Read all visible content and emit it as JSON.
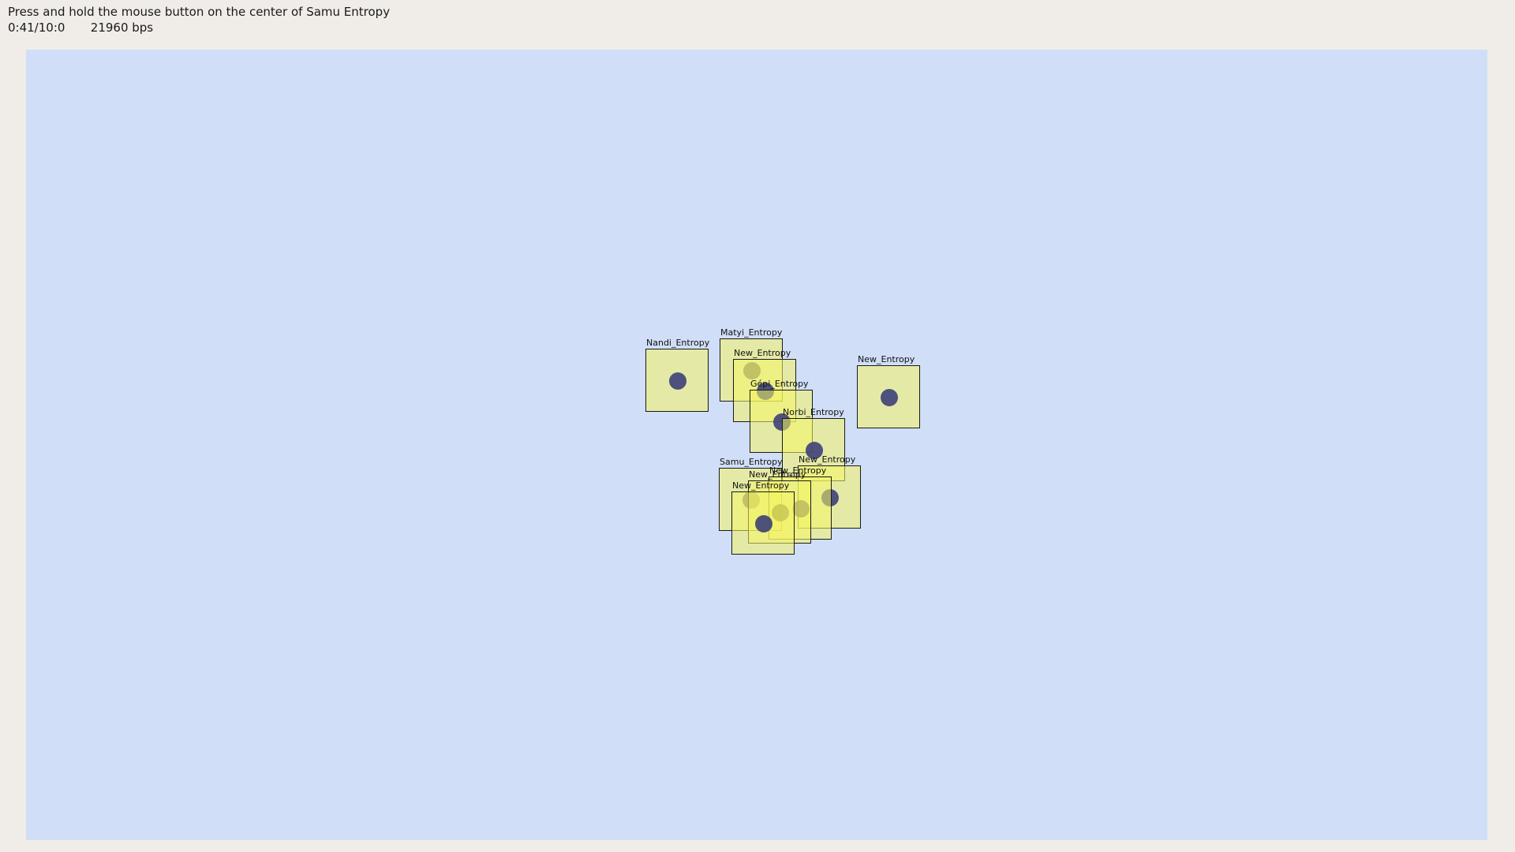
{
  "header": {
    "instruction": "Press and hold the mouse button on the center of Samu Entropy",
    "timer": "0:41/10:0",
    "bitrate": "21960 bps"
  },
  "entities": [
    {
      "label": "Nandi_Entropy"
    },
    {
      "label": "Matyi_Entropy"
    },
    {
      "label": "New_Entropy"
    },
    {
      "label": "Gépi_Entropy"
    },
    {
      "label": "Norbi_Entropy"
    },
    {
      "label": "New_Entropy"
    },
    {
      "label": "Samu_Entropy"
    },
    {
      "label": "New_Entropy"
    },
    {
      "label": "New_Entropy"
    },
    {
      "label": "New_Entropy"
    },
    {
      "label": "New_Entropy"
    }
  ],
  "colors": {
    "canvas_background": "#d0def7",
    "window_background": "#f0ede8",
    "entity_fill": "#f4f464",
    "dot_fill": "#3c4078"
  }
}
